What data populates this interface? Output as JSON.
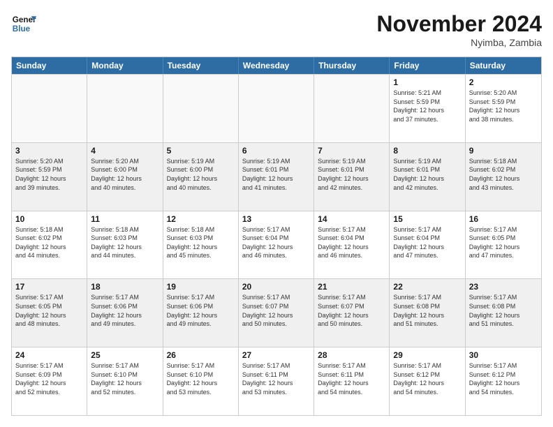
{
  "logo": {
    "line1": "General",
    "line2": "Blue"
  },
  "title": "November 2024",
  "location": "Nyimba, Zambia",
  "weekdays": [
    "Sunday",
    "Monday",
    "Tuesday",
    "Wednesday",
    "Thursday",
    "Friday",
    "Saturday"
  ],
  "rows": [
    [
      {
        "day": "",
        "info": ""
      },
      {
        "day": "",
        "info": ""
      },
      {
        "day": "",
        "info": ""
      },
      {
        "day": "",
        "info": ""
      },
      {
        "day": "",
        "info": ""
      },
      {
        "day": "1",
        "info": "Sunrise: 5:21 AM\nSunset: 5:59 PM\nDaylight: 12 hours\nand 37 minutes."
      },
      {
        "day": "2",
        "info": "Sunrise: 5:20 AM\nSunset: 5:59 PM\nDaylight: 12 hours\nand 38 minutes."
      }
    ],
    [
      {
        "day": "3",
        "info": "Sunrise: 5:20 AM\nSunset: 5:59 PM\nDaylight: 12 hours\nand 39 minutes."
      },
      {
        "day": "4",
        "info": "Sunrise: 5:20 AM\nSunset: 6:00 PM\nDaylight: 12 hours\nand 40 minutes."
      },
      {
        "day": "5",
        "info": "Sunrise: 5:19 AM\nSunset: 6:00 PM\nDaylight: 12 hours\nand 40 minutes."
      },
      {
        "day": "6",
        "info": "Sunrise: 5:19 AM\nSunset: 6:01 PM\nDaylight: 12 hours\nand 41 minutes."
      },
      {
        "day": "7",
        "info": "Sunrise: 5:19 AM\nSunset: 6:01 PM\nDaylight: 12 hours\nand 42 minutes."
      },
      {
        "day": "8",
        "info": "Sunrise: 5:19 AM\nSunset: 6:01 PM\nDaylight: 12 hours\nand 42 minutes."
      },
      {
        "day": "9",
        "info": "Sunrise: 5:18 AM\nSunset: 6:02 PM\nDaylight: 12 hours\nand 43 minutes."
      }
    ],
    [
      {
        "day": "10",
        "info": "Sunrise: 5:18 AM\nSunset: 6:02 PM\nDaylight: 12 hours\nand 44 minutes."
      },
      {
        "day": "11",
        "info": "Sunrise: 5:18 AM\nSunset: 6:03 PM\nDaylight: 12 hours\nand 44 minutes."
      },
      {
        "day": "12",
        "info": "Sunrise: 5:18 AM\nSunset: 6:03 PM\nDaylight: 12 hours\nand 45 minutes."
      },
      {
        "day": "13",
        "info": "Sunrise: 5:17 AM\nSunset: 6:04 PM\nDaylight: 12 hours\nand 46 minutes."
      },
      {
        "day": "14",
        "info": "Sunrise: 5:17 AM\nSunset: 6:04 PM\nDaylight: 12 hours\nand 46 minutes."
      },
      {
        "day": "15",
        "info": "Sunrise: 5:17 AM\nSunset: 6:04 PM\nDaylight: 12 hours\nand 47 minutes."
      },
      {
        "day": "16",
        "info": "Sunrise: 5:17 AM\nSunset: 6:05 PM\nDaylight: 12 hours\nand 47 minutes."
      }
    ],
    [
      {
        "day": "17",
        "info": "Sunrise: 5:17 AM\nSunset: 6:05 PM\nDaylight: 12 hours\nand 48 minutes."
      },
      {
        "day": "18",
        "info": "Sunrise: 5:17 AM\nSunset: 6:06 PM\nDaylight: 12 hours\nand 49 minutes."
      },
      {
        "day": "19",
        "info": "Sunrise: 5:17 AM\nSunset: 6:06 PM\nDaylight: 12 hours\nand 49 minutes."
      },
      {
        "day": "20",
        "info": "Sunrise: 5:17 AM\nSunset: 6:07 PM\nDaylight: 12 hours\nand 50 minutes."
      },
      {
        "day": "21",
        "info": "Sunrise: 5:17 AM\nSunset: 6:07 PM\nDaylight: 12 hours\nand 50 minutes."
      },
      {
        "day": "22",
        "info": "Sunrise: 5:17 AM\nSunset: 6:08 PM\nDaylight: 12 hours\nand 51 minutes."
      },
      {
        "day": "23",
        "info": "Sunrise: 5:17 AM\nSunset: 6:08 PM\nDaylight: 12 hours\nand 51 minutes."
      }
    ],
    [
      {
        "day": "24",
        "info": "Sunrise: 5:17 AM\nSunset: 6:09 PM\nDaylight: 12 hours\nand 52 minutes."
      },
      {
        "day": "25",
        "info": "Sunrise: 5:17 AM\nSunset: 6:10 PM\nDaylight: 12 hours\nand 52 minutes."
      },
      {
        "day": "26",
        "info": "Sunrise: 5:17 AM\nSunset: 6:10 PM\nDaylight: 12 hours\nand 53 minutes."
      },
      {
        "day": "27",
        "info": "Sunrise: 5:17 AM\nSunset: 6:11 PM\nDaylight: 12 hours\nand 53 minutes."
      },
      {
        "day": "28",
        "info": "Sunrise: 5:17 AM\nSunset: 6:11 PM\nDaylight: 12 hours\nand 54 minutes."
      },
      {
        "day": "29",
        "info": "Sunrise: 5:17 AM\nSunset: 6:12 PM\nDaylight: 12 hours\nand 54 minutes."
      },
      {
        "day": "30",
        "info": "Sunrise: 5:17 AM\nSunset: 6:12 PM\nDaylight: 12 hours\nand 54 minutes."
      }
    ]
  ]
}
